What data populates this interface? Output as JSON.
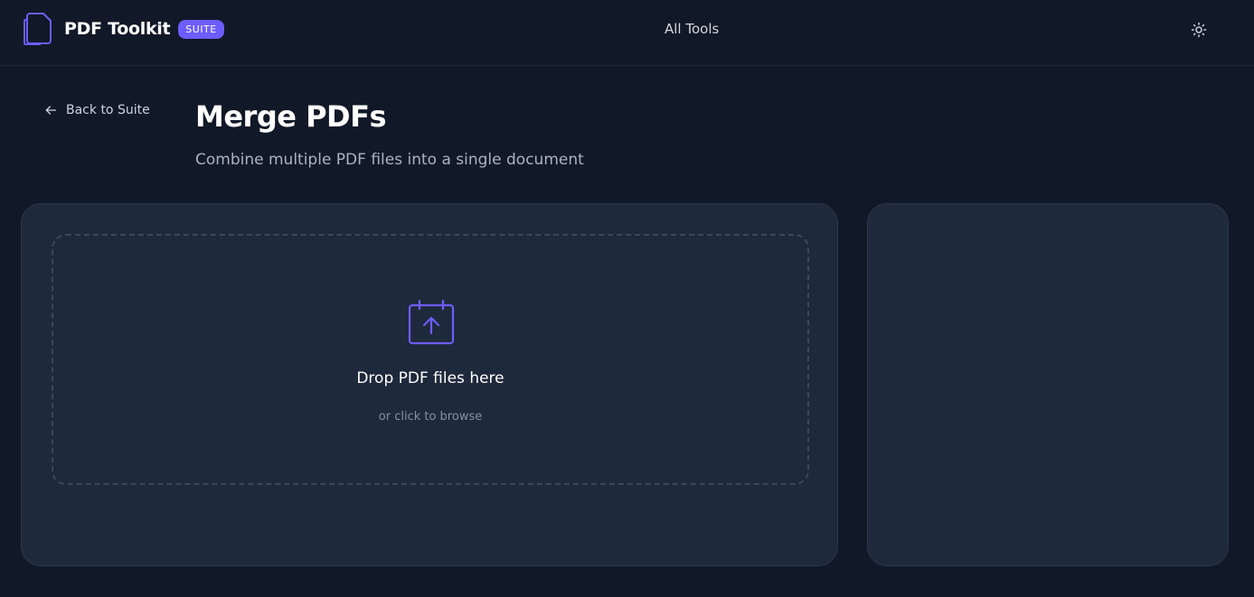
{
  "header": {
    "brand_name": "PDF Toolkit",
    "badge": "SUITE",
    "nav_all_tools": "All Tools",
    "theme_icon": "sun-icon"
  },
  "page": {
    "back_label": "Back to Suite",
    "title": "Merge PDFs",
    "subtitle": "Combine multiple PDF files into a single document"
  },
  "dropzone": {
    "icon": "upload-calendar-icon",
    "title": "Drop PDF files here",
    "subtitle": "or click to browse"
  },
  "colors": {
    "accent": "#6d5dfc",
    "background": "#111827",
    "panel": "#1e293b"
  }
}
